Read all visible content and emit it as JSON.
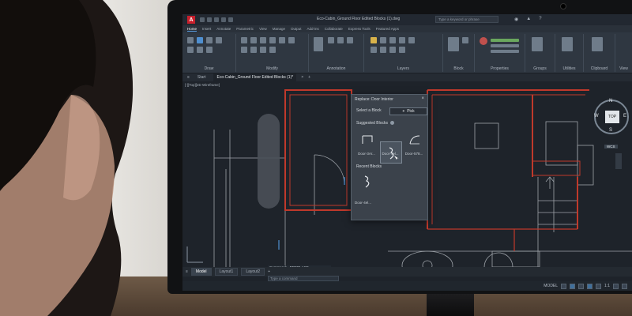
{
  "app": {
    "title": "Eco-Cabin_Ground Floor Edited Blocks (1).dwg",
    "search_placeholder": "Type a keyword or phrase",
    "logo_letter": "A",
    "tabs": [
      "Home",
      "Insert",
      "Annotate",
      "Parametric",
      "View",
      "Manage",
      "Output",
      "Add-ins",
      "Collaborate",
      "Express Tools",
      "Featured Apps"
    ],
    "active_tab": "Home",
    "ribbon_panels": [
      "Draw",
      "Modify",
      "Annotation",
      "Layers",
      "Block",
      "Properties",
      "Groups",
      "Utilities",
      "Clipboard",
      "View"
    ],
    "file_tabs": [
      "Start",
      "Eco-Cabin_Ground Floor Edited Blocks (1)*"
    ],
    "viewport_label": "[-][Top][2D Wireframe]",
    "layout_tabs": [
      "Model",
      "Layout1",
      "Layout2"
    ],
    "command_history": [
      "Command: _BREPLACE",
      "1 Found"
    ],
    "command_placeholder": "Type a command",
    "status_model": "MODEL",
    "status_scale": "1:1"
  },
  "dialog": {
    "title": "Replace: Door Interior",
    "select_label": "Select a Block",
    "pick_label": "Pick",
    "suggested_label": "Suggested Blocks",
    "suggested": [
      "Door-3Ar...",
      "Door-4el...",
      "Door-578..."
    ],
    "recent_label": "Recent Blocks",
    "recent": [
      "Door-4el..."
    ]
  },
  "viewcube": {
    "top": "TOP",
    "n": "N",
    "s": "S",
    "e": "E",
    "w": "W",
    "wcs": "WCS"
  },
  "colors": {
    "accent": "#c8202c",
    "wall": "#c0392b",
    "select": "#4f8fd0",
    "drawing_bg": "#1e232a"
  },
  "icons": [
    "autocad-logo-icon",
    "search-icon",
    "close-icon",
    "pick-cursor-icon",
    "info-icon",
    "viewcube-icon"
  ]
}
